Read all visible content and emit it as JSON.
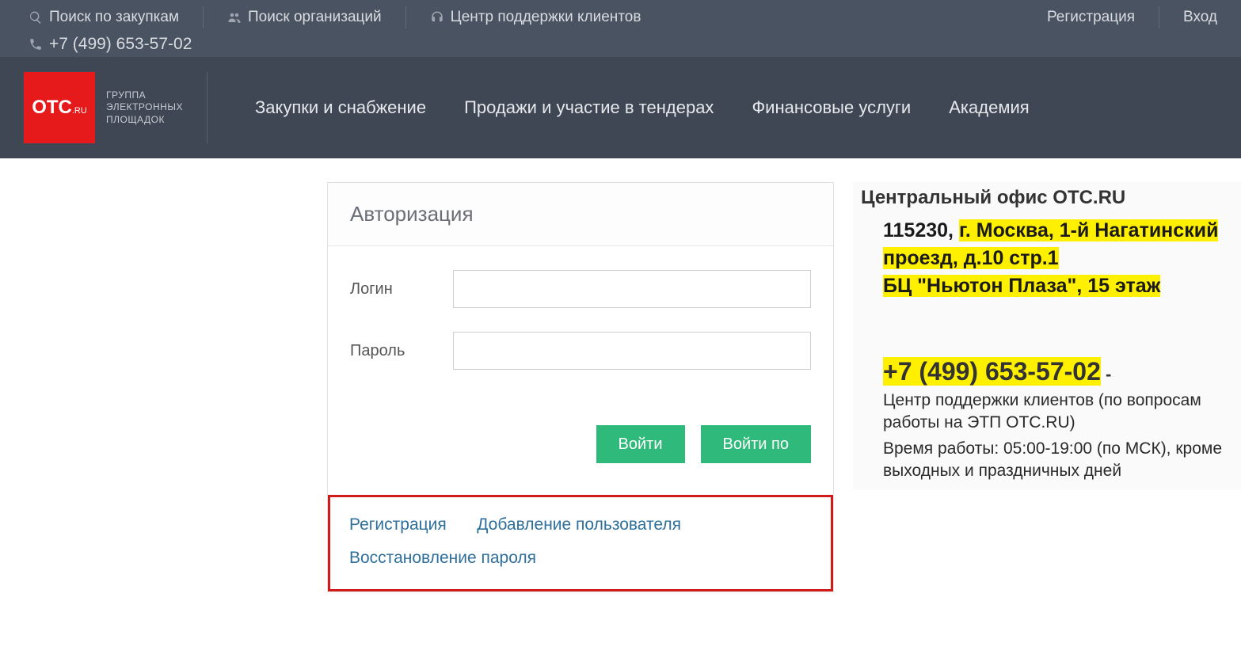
{
  "topbar": {
    "search_purchases": "Поиск по закупкам",
    "search_orgs": "Поиск организаций",
    "support_center": "Центр поддержки клиентов",
    "phone": "+7 (499) 653-57-02",
    "register": "Регистрация",
    "login": "Вход"
  },
  "logo": {
    "brand": "OTC",
    "brand_sub": ".RU",
    "tagline_l1": "ГРУППА",
    "tagline_l2": "ЭЛЕКТРОННЫХ",
    "tagline_l3": "ПЛОЩАДОК"
  },
  "nav": {
    "item1": "Закупки и снабжение",
    "item2": "Продажи и участие в тендерах",
    "item3": "Финансовые услуги",
    "item4": "Академия"
  },
  "auth": {
    "title": "Авторизация",
    "login_label": "Логин",
    "password_label": "Пароль",
    "login_value": "",
    "password_value": "",
    "btn_enter": "Войти",
    "btn_enter_by": "Войти по"
  },
  "links": {
    "register": "Регистрация",
    "add_user": "Добавление пользователя",
    "recover": "Восстановление пароля"
  },
  "contact": {
    "title": "Центральный офис OTC.RU",
    "addr_zip": "115230, ",
    "addr_line": "г. Москва, 1-й Нагатинский проезд, д.10 стр.1",
    "bc": "БЦ \"Ньютон Плаза\", 15 этаж",
    "phone": "+7 (499) 653-57-02",
    "phone_dash": " -",
    "support": "Центр поддержки клиентов (по вопросам работы на ЭТП OTC.RU)",
    "hours": "Время работы: 05:00-19:00 (по МСК), кроме выходных и праздничных дней"
  }
}
